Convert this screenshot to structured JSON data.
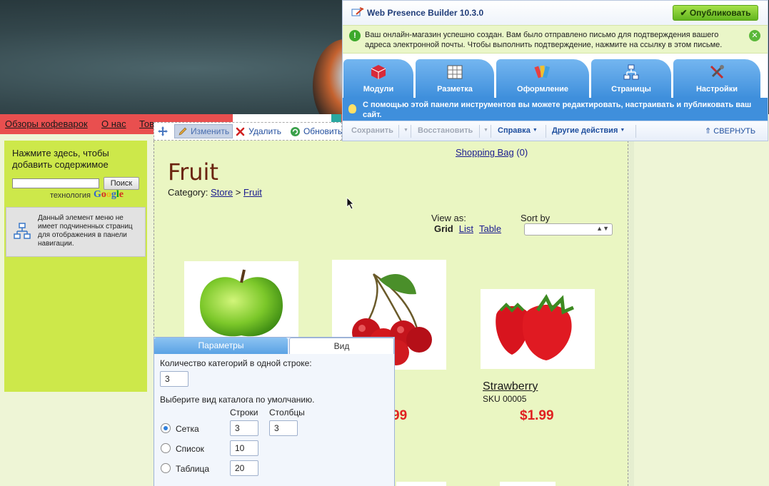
{
  "site": {
    "nav": [
      "Обзоры кофеварок",
      "О нас",
      "Тов"
    ],
    "sidebar": {
      "hint": "Нажмите здесь, чтобы добавить содержимое",
      "search_button": "Поиск",
      "tech_label": "технология",
      "google_letters": [
        "G",
        "o",
        "o",
        "g",
        "l",
        "e"
      ],
      "menu_note": "Данный элемент меню не имеет подчиненных страниц для отображения в панели навигации."
    },
    "edit_toolbar": {
      "edit": "Изменить",
      "delete": "Удалить",
      "refresh": "Обновить"
    },
    "shopping_bag": {
      "label": "Shopping Bag",
      "count": "(0)"
    },
    "page_title": "Fruit",
    "category": {
      "label": "Category:",
      "store": "Store",
      "sep": ">",
      "current": "Fruit"
    },
    "view_as": {
      "label": "View as:",
      "grid": "Grid",
      "list": "List",
      "table": "Table"
    },
    "sort_by": {
      "label": "Sort by",
      "value": ""
    },
    "products": [
      {
        "name": "",
        "sku": "",
        "price": "",
        "image": "apple"
      },
      {
        "name": "",
        "sku": "",
        "price": "99",
        "image": "cherry"
      },
      {
        "name": "Strawberry",
        "sku": "SKU 00005",
        "price": "$1.99",
        "image": "strawberry"
      }
    ]
  },
  "panel": {
    "tabs": [
      "Параметры",
      "Вид"
    ],
    "active_tab": "Вид",
    "categories_per_row_label": "Количество категорий в одной строке:",
    "categories_per_row": "3",
    "default_view_label": "Выберите вид каталога по умолчанию.",
    "rows_header": "Строки",
    "cols_header": "Столбцы",
    "views": [
      {
        "label": "Сетка",
        "selected": true,
        "rows": "3",
        "cols": "3"
      },
      {
        "label": "Список",
        "selected": false,
        "rows": "10"
      },
      {
        "label": "Таблица",
        "selected": false,
        "rows": "20"
      }
    ]
  },
  "wpb": {
    "title": "Web Presence Builder 10.3.0",
    "publish": "Опубликовать",
    "notice": "Ваш онлайн-магазин успешно создан. Вам было отправлено письмо для подтверждения вашего адреса электронной почты. Чтобы выполнить подтверждение, нажмите на ссылку в этом письме.",
    "tabs": [
      "Модули",
      "Разметка",
      "Оформление",
      "Страницы",
      "Настройки"
    ],
    "info": "С помощью этой панели инструментов вы можете редактировать, настраивать и публиковать ваш сайт.",
    "actions": {
      "save": "Сохранить",
      "restore": "Восстановить",
      "help": "Справка",
      "other": "Другие действия",
      "collapse": "СВЕРНУТЬ"
    }
  },
  "colors": {
    "accent": "#3f8fdc",
    "price": "#e02020",
    "sidebar": "#cde84a",
    "nav": "#e94f4f",
    "publish": "#62b51e"
  }
}
